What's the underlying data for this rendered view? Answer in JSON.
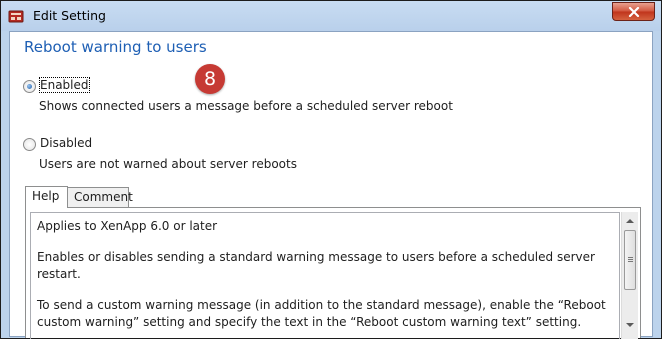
{
  "window": {
    "title": "Edit Setting",
    "close_glyph": "✕"
  },
  "setting": {
    "heading": "Reboot warning to users",
    "step_badge": "8"
  },
  "options": {
    "enabled": {
      "label": "Enabled",
      "description": "Shows connected users a message before a scheduled server reboot",
      "selected": true
    },
    "disabled": {
      "label": "Disabled",
      "description": "Users are not warned about server reboots",
      "selected": false
    }
  },
  "tabs": [
    {
      "label": "Help",
      "active": true
    },
    {
      "label": "Comment",
      "active": false
    }
  ],
  "help": {
    "paragraphs": [
      "Applies to XenApp 6.0 or later",
      "Enables or disables sending a standard warning message to users before a scheduled server restart.",
      "To send a custom warning message (in addition to the standard message), enable the “Reboot custom warning” setting and specify the text in the “Reboot custom warning text” setting."
    ]
  },
  "colors": {
    "heading": "#1e5fb4",
    "badge": "#c63a34",
    "close_button": "#c0341c",
    "titlebar": "#bcd3ec"
  }
}
